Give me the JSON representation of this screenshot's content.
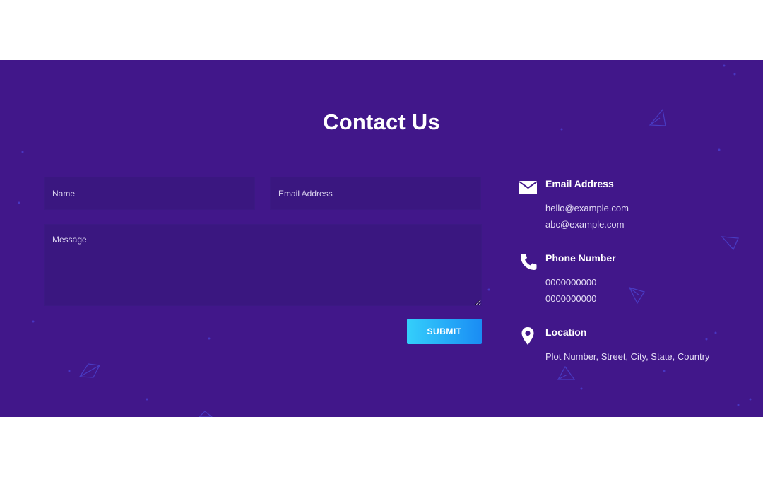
{
  "page": {
    "title": "Contact Us",
    "colors": {
      "section_background": "#41178a",
      "field_background": "#3a1780",
      "button_gradient_start": "#34cffb",
      "button_gradient_end": "#1a8cf4",
      "text": "#ffffff"
    }
  },
  "form": {
    "name_placeholder": "Name",
    "email_placeholder": "Email Address",
    "message_placeholder": "Message",
    "submit_label": "SUBMIT"
  },
  "contact_info": {
    "email": {
      "icon": "envelope-icon",
      "heading": "Email Address",
      "lines": [
        "hello@example.com",
        "abc@example.com"
      ]
    },
    "phone": {
      "icon": "phone-icon",
      "heading": "Phone Number",
      "lines": [
        "0000000000",
        "0000000000"
      ]
    },
    "location": {
      "icon": "map-pin-icon",
      "heading": "Location",
      "lines": [
        "Plot Number, Street, City, State, Country"
      ]
    }
  }
}
